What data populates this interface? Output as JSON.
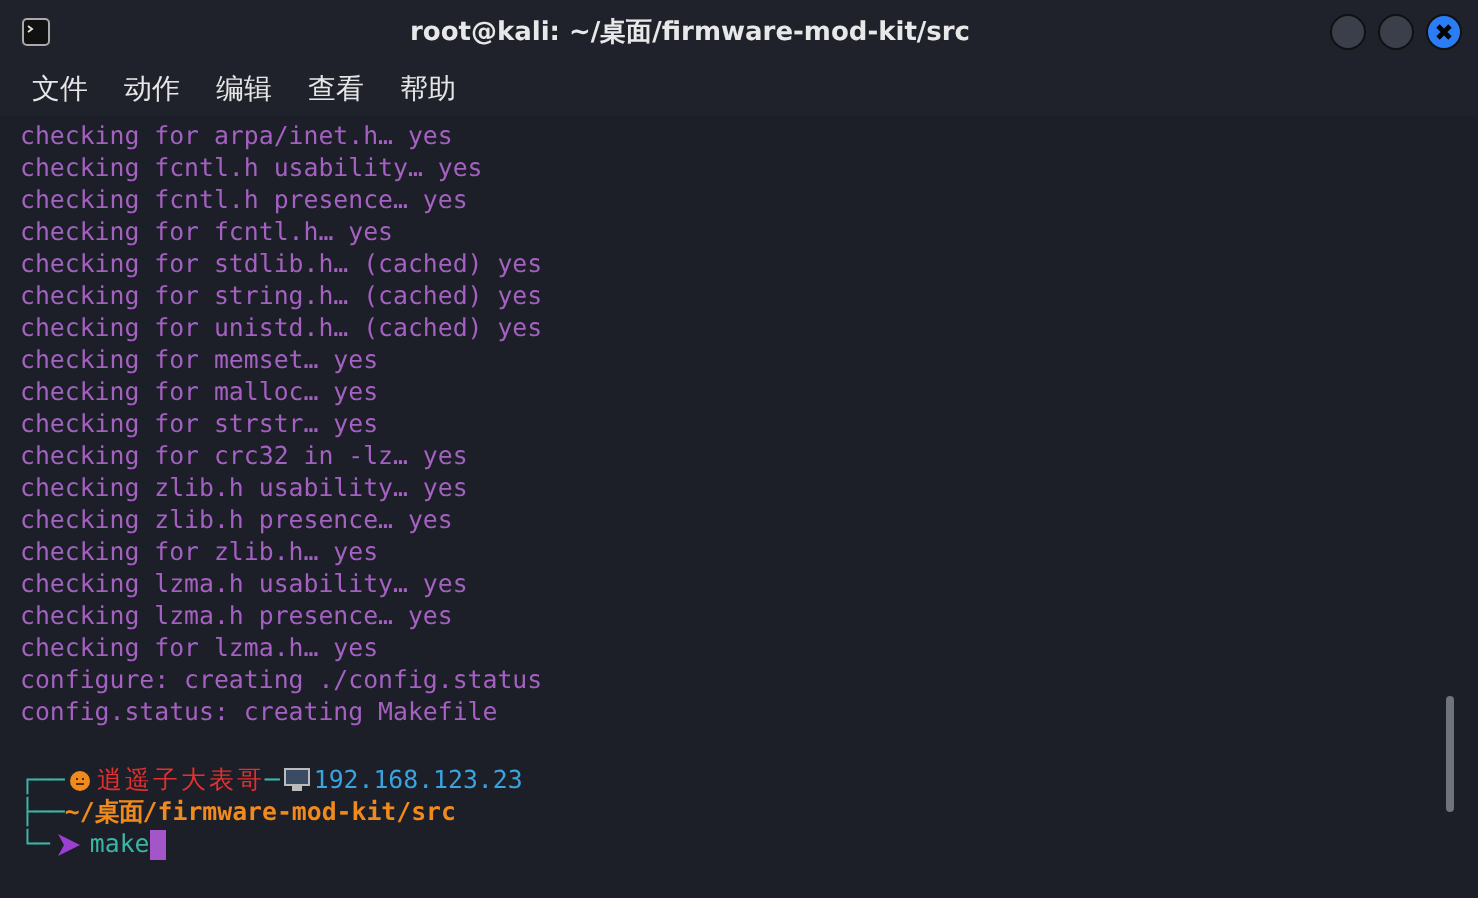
{
  "window": {
    "title": "root@kali: ~/桌面/firmware-mod-kit/src"
  },
  "menu": [
    "文件",
    "动作",
    "编辑",
    "查看",
    "帮助"
  ],
  "output": [
    "checking for arpa/inet.h… yes",
    "checking fcntl.h usability… yes",
    "checking fcntl.h presence… yes",
    "checking for fcntl.h… yes",
    "checking for stdlib.h… (cached) yes",
    "checking for string.h… (cached) yes",
    "checking for unistd.h… (cached) yes",
    "checking for memset… yes",
    "checking for malloc… yes",
    "checking for strstr… yes",
    "checking for crc32 in -lz… yes",
    "checking zlib.h usability… yes",
    "checking zlib.h presence… yes",
    "checking for zlib.h… yes",
    "checking lzma.h usability… yes",
    "checking lzma.h presence… yes",
    "checking for lzma.h… yes",
    "configure: creating ./config.status",
    "config.status: creating Makefile"
  ],
  "prompt": {
    "top_branch": "┌──",
    "user": "逍遥子大表哥",
    "separator": "─",
    "host": "192.168.123.23",
    "mid_branch": "├──",
    "path": "~/桌面/firmware-mod-kit/src",
    "bottom_branch": "└─",
    "command": "make"
  }
}
